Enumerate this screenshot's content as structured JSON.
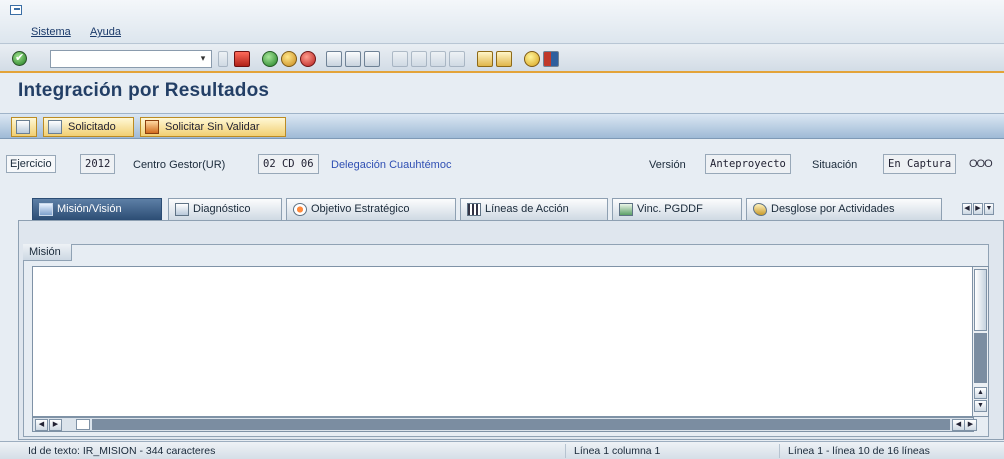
{
  "menu": {
    "items": [
      "Sistema",
      "Ayuda"
    ]
  },
  "toolbar": {
    "command_value": "",
    "icons": [
      "enter-icon",
      "save-icon",
      "back-icon",
      "exit-icon",
      "cancel-icon",
      "print-icon",
      "find-icon",
      "find-next-icon",
      "first-page-icon",
      "previous-page-icon",
      "next-page-icon",
      "last-page-icon",
      "create-session-icon",
      "shortcut-icon",
      "help-icon",
      "layout-icon"
    ]
  },
  "page": {
    "title": "Integración por Resultados"
  },
  "app_toolbar": {
    "solicitado_label": "Solicitado",
    "solicitar_sin_validar_label": "Solicitar Sin Validar"
  },
  "header": {
    "ejercicio_label": "Ejercicio",
    "ejercicio_value": "2012",
    "centro_label": "Centro Gestor(UR)",
    "centro_value": "02 CD 06",
    "centro_desc": "Delegación Cuauhtémoc",
    "version_label": "Versión",
    "version_value": "Anteproyecto",
    "situacion_label": "Situación",
    "situacion_value": "En Captura",
    "status_indicator": "OOO"
  },
  "tabs": [
    {
      "label": "Misión/Visión",
      "active": true
    },
    {
      "label": "Diagnóstico",
      "active": false
    },
    {
      "label": "Objetivo Estratégico",
      "active": false
    },
    {
      "label": "Líneas de Acción",
      "active": false
    },
    {
      "label": "Vinc. PGDDF",
      "active": false
    },
    {
      "label": "Desglose por Actividades",
      "active": false
    }
  ],
  "group": {
    "label": "Misión"
  },
  "editor": {
    "text": ""
  },
  "statusbar": {
    "text_id": "Id de texto: IR_MISION - 344 caracteres",
    "position": "Línea 1 columna 1",
    "lines": "Línea 1 - línea 10 de 16 líneas"
  },
  "colors": {
    "title": "#233f66",
    "active_tab": "#2c4d74",
    "toolbar_accent": "#e3a338",
    "link": "#2f4fb3"
  }
}
